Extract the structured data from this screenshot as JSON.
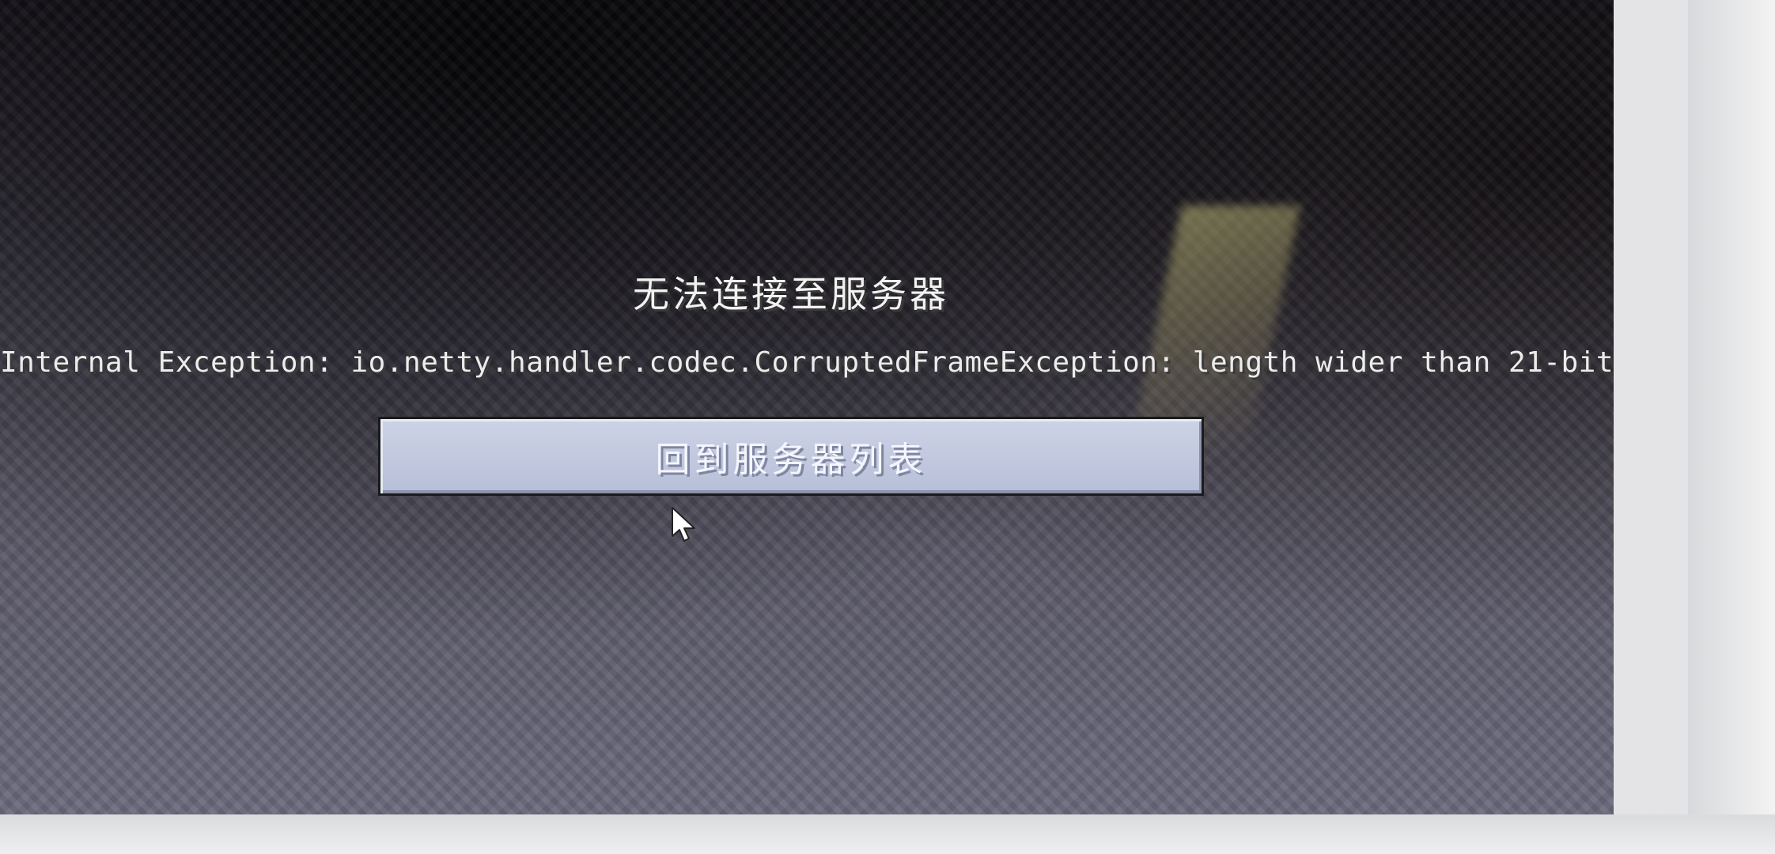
{
  "screen": {
    "title": "无法连接至服务器",
    "reason": "Internal Exception: io.netty.handler.codec.CorruptedFrameException: length wider than 21-bit",
    "back_button_label": "回到服务器列表"
  },
  "colors": {
    "text": "#f2f2f2",
    "button_fill": "#c4cbe0",
    "button_border": "#1a1a1a",
    "background": "#4a4650"
  },
  "icons": {
    "cursor": "mouse-pointer-icon"
  }
}
